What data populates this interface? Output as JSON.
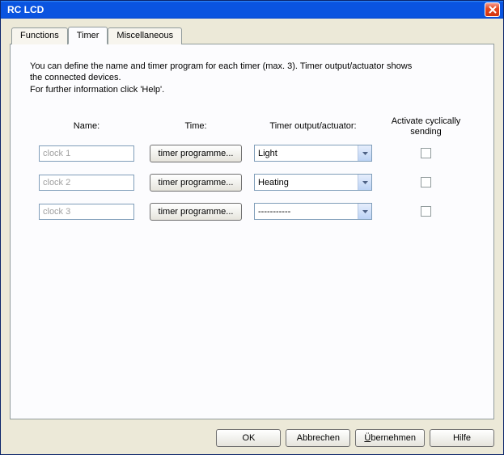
{
  "window": {
    "title": "RC LCD"
  },
  "tabs": {
    "functions": "Functions",
    "timer": "Timer",
    "misc": "Miscellaneous"
  },
  "help": {
    "line1": "You can define the name and timer program for each timer (max. 3). Timer output/actuator shows",
    "line2": "the connected devices.",
    "line3": "For further information click 'Help'."
  },
  "headers": {
    "name": "Name:",
    "time": "Time:",
    "output": "Timer output/actuator:",
    "activate": "Activate cyclically sending"
  },
  "rows": [
    {
      "name": "clock 1",
      "time_btn": "timer programme...",
      "output": "Light",
      "checked": false
    },
    {
      "name": "clock 2",
      "time_btn": "timer programme...",
      "output": "Heating",
      "checked": false
    },
    {
      "name": "clock 3",
      "time_btn": "timer programme...",
      "output": "-----------",
      "checked": false
    }
  ],
  "buttons": {
    "ok": "OK",
    "cancel": "Abbrechen",
    "apply": "Übernehmen",
    "help": "Hilfe"
  }
}
